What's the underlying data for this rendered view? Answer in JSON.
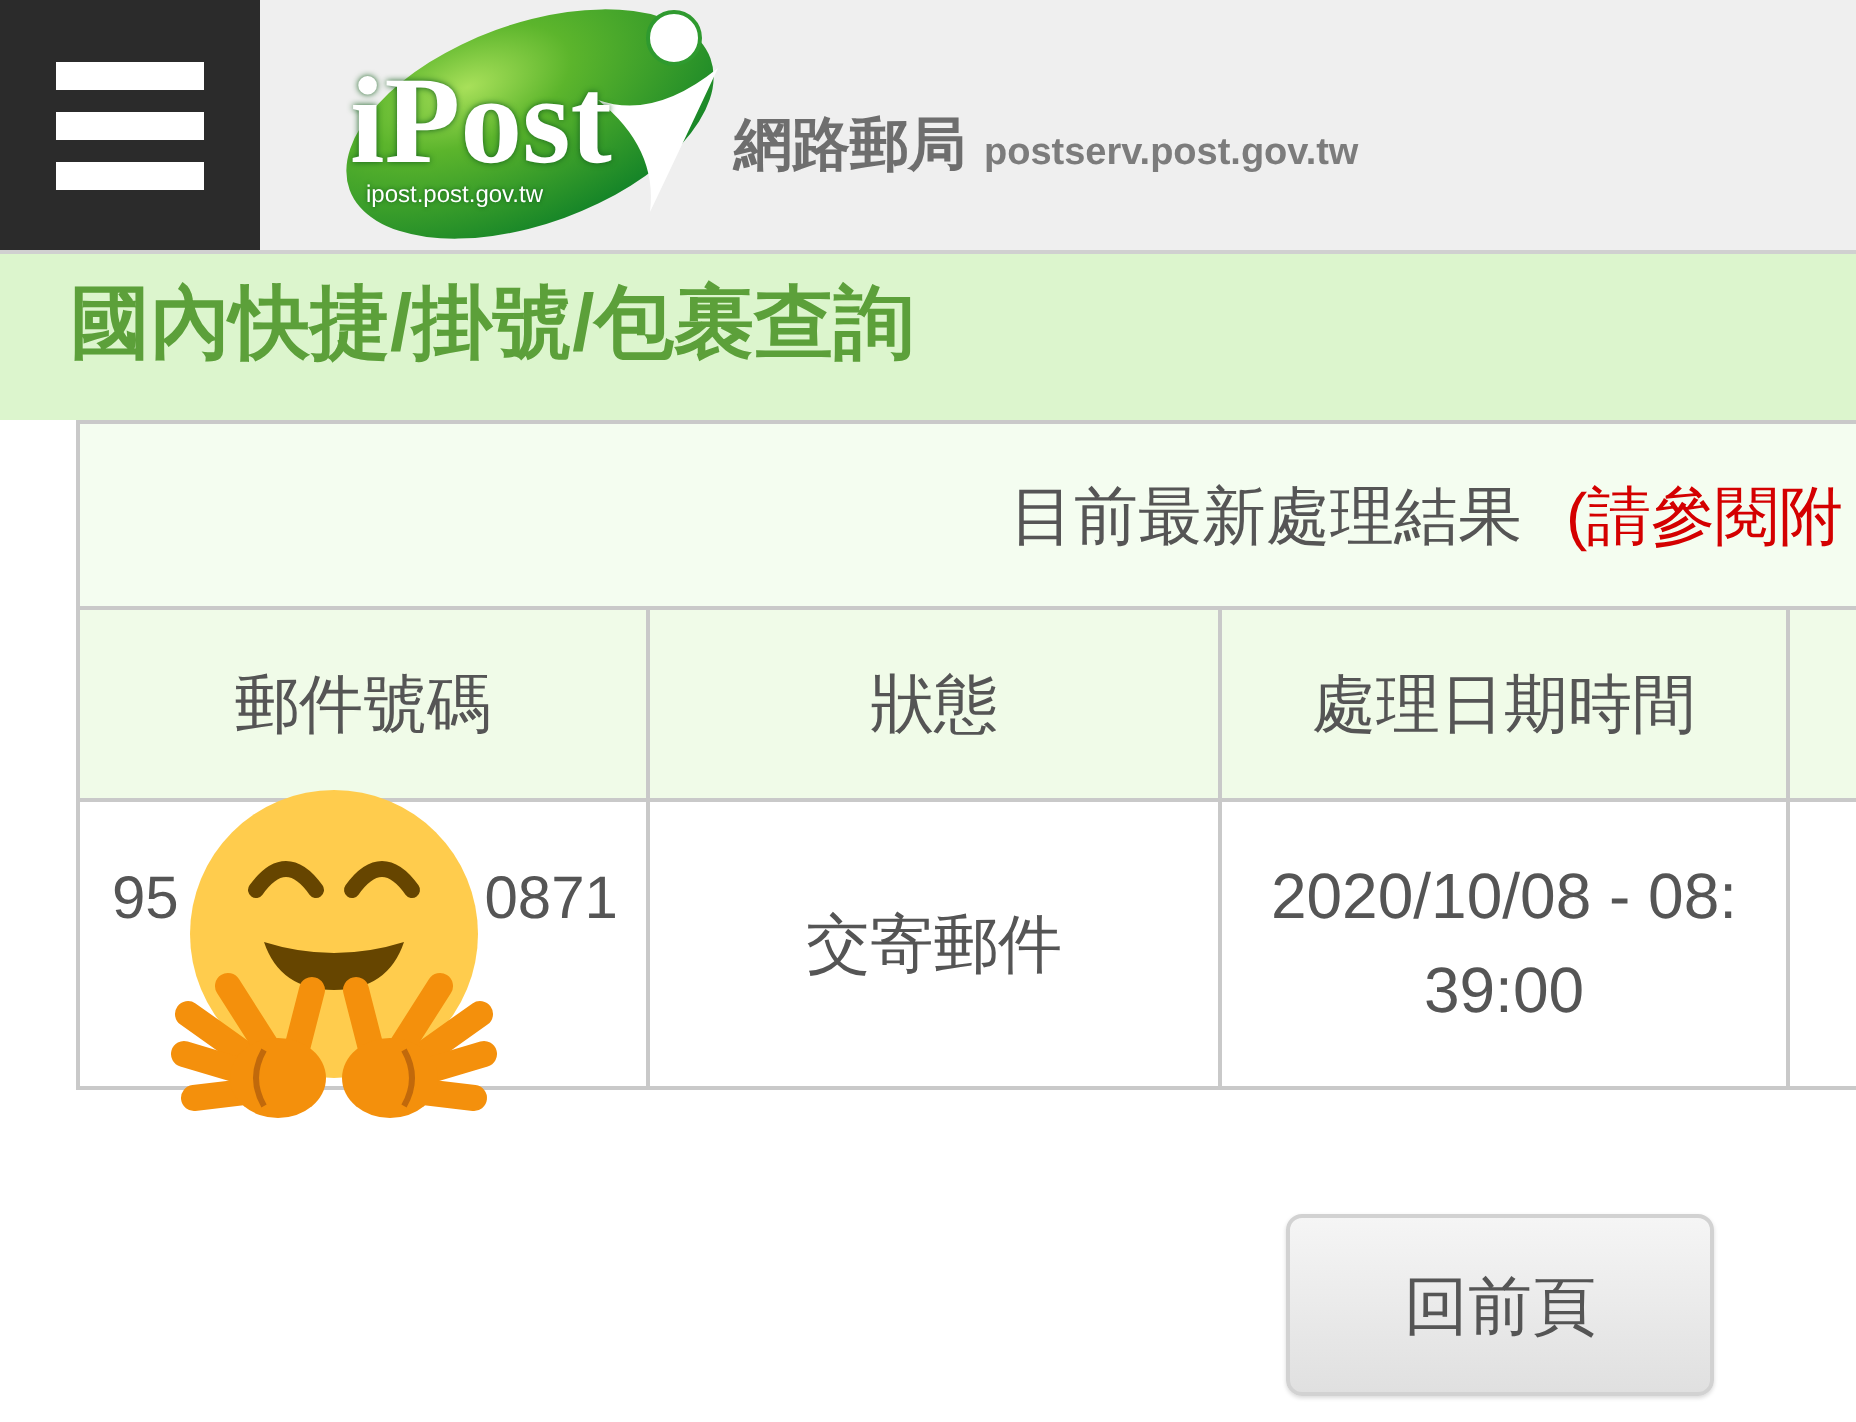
{
  "header": {
    "logo_wordmark": "iPost",
    "logo_url": "ipost.post.gov.tw",
    "site_name": "網路郵局",
    "site_url": "postserv.post.gov.tw"
  },
  "page_title": "國內快捷/掛號/包裹查詢",
  "table": {
    "caption": "目前最新處理結果",
    "caption_note": "(請參閱附",
    "columns": [
      "郵件號碼",
      "狀態",
      "處理日期時間"
    ],
    "rows": [
      {
        "mail_number_visible": [
          "95",
          "0871"
        ],
        "status": "交寄郵件",
        "datetime": "2020/10/08 - 08:39:00"
      }
    ]
  },
  "buttons": [
    {
      "label": "回前頁"
    }
  ]
}
